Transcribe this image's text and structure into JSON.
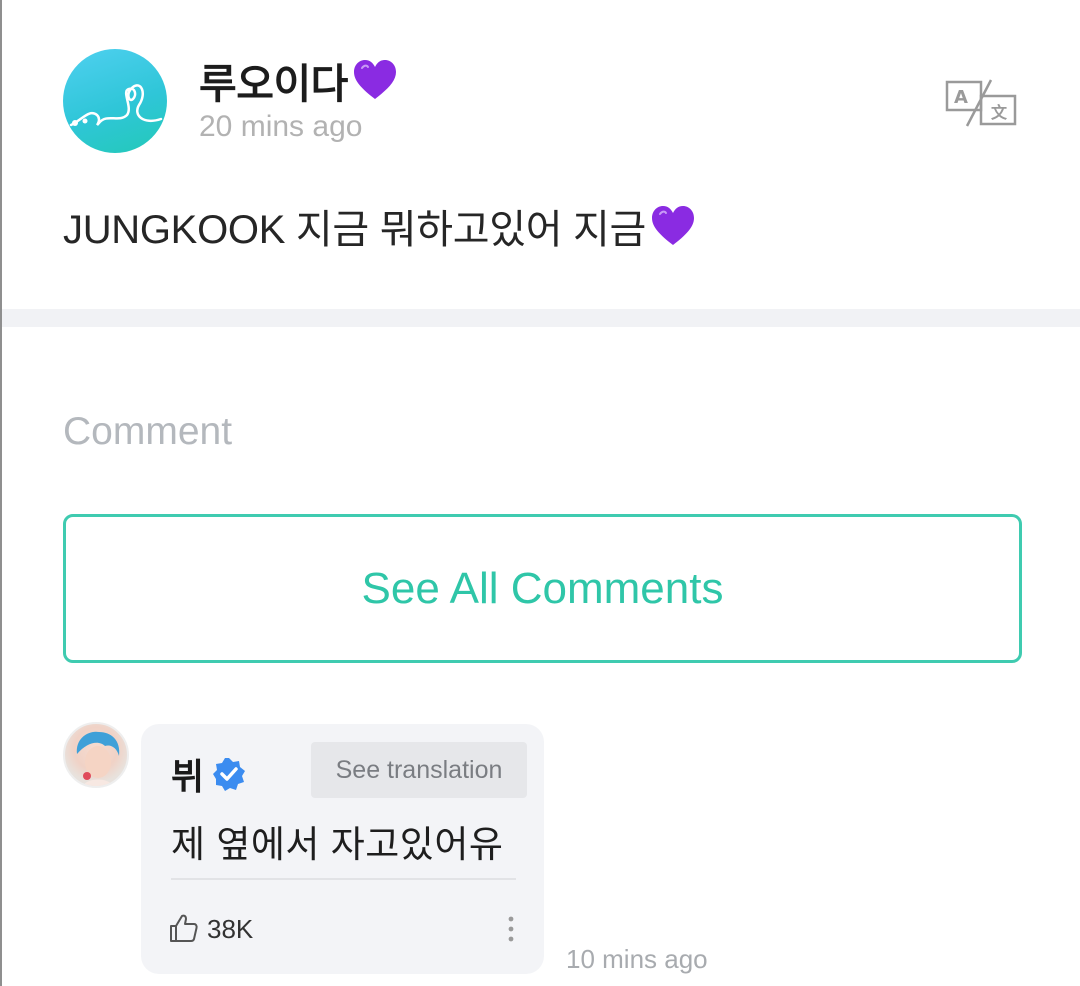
{
  "post": {
    "author_name": "루오이다",
    "author_emoji": "purple-heart-emoji",
    "time": "20 mins ago",
    "body": "JUNGKOOK 지금 뭐하고있어 지금",
    "body_emoji": "purple-heart-emoji",
    "translate_icon": "translate-icon"
  },
  "comments_section": {
    "heading": "Comment",
    "see_all_label": "See All Comments"
  },
  "comment": {
    "author_name": "뷔",
    "verified_icon": "verified-badge-icon",
    "see_translation_label": "See translation",
    "text": "제 옆에서 자고있어유",
    "like_icon": "thumbs-up-icon",
    "likes": "38K",
    "more_icon": "more-vertical-icon",
    "time": "10 mins ago"
  },
  "colors": {
    "accent": "#2fc6a8",
    "heart": "#8a2be2",
    "verified": "#3b8cf0"
  }
}
